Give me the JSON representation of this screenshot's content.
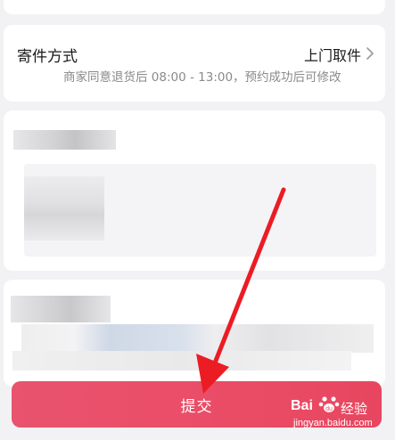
{
  "shipping": {
    "title": "寄件方式",
    "value": "上门取件",
    "note": "商家同意退货后 08:00 - 13:00，预约成功后可修改"
  },
  "submit_label": "提交",
  "watermark": {
    "logo": "Bai",
    "text": "经验",
    "url": "jingyan.baidu.com"
  },
  "colors": {
    "submit_button": "#ea4c66",
    "arrow": "#ec1c24",
    "background": "#f2f2f4"
  }
}
